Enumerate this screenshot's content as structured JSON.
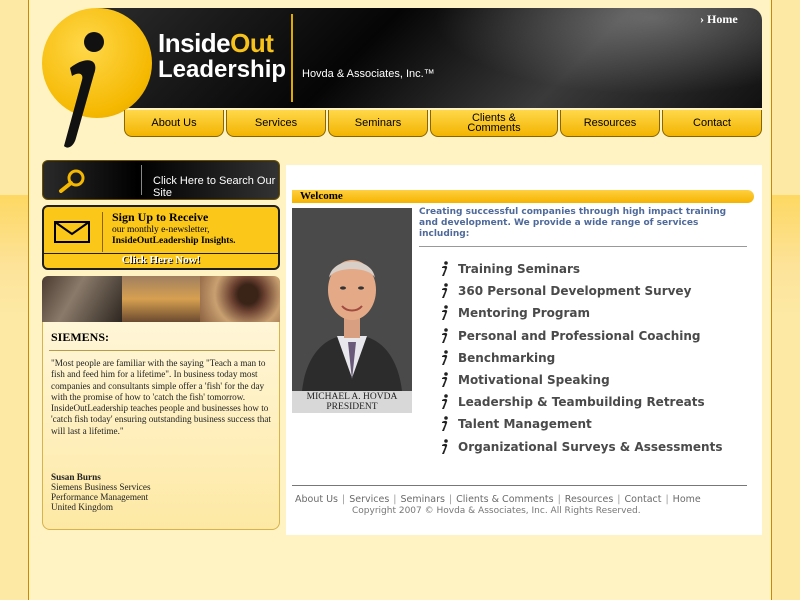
{
  "header": {
    "home_link": "› Home",
    "brand_part1": "Inside",
    "brand_part2": "Out",
    "brand_line2": "Leadership",
    "company": "Hovda & Associates, Inc.™"
  },
  "nav": [
    {
      "label": "About Us"
    },
    {
      "label": "Services"
    },
    {
      "label": "Seminars"
    },
    {
      "label": "Clients & Comments"
    },
    {
      "label": "Resources"
    },
    {
      "label": "Contact"
    }
  ],
  "sidebar": {
    "search_label": "Click Here to Search Our Site",
    "signup_title": "Sign Up to Receive",
    "signup_sub": "our monthly e-newsletter,",
    "signup_sub2": "InsideOutLeadership Insights.",
    "signup_button": "Click Here Now!",
    "testimonial": {
      "company": "SIEMENS:",
      "quote": "\"Most people are familiar with the saying \"Teach a man to fish and feed him for a lifetime\". In business today most companies and consultants simple offer a 'fish' for the day with the promise of how to 'catch the fish' tomorrow. InsideOutLeadership teaches people and businesses how to 'catch fish today' ensuring outstanding business success that will last a lifetime.\"",
      "author_name": "Susan Burns",
      "author_line2": "Siemens Business Services",
      "author_line3": "Performance Management",
      "author_line4": "United Kingdom"
    }
  },
  "main": {
    "welcome_title": "Welcome",
    "portrait_name": "MICHAEL A. HOVDA",
    "portrait_title": "PRESIDENT",
    "intro": "Creating successful companies through high impact training and development. We provide a wide range of services including:",
    "services": [
      "Training Seminars",
      "360 Personal Development Survey",
      "Mentoring Program",
      "Personal and Professional Coaching",
      "Benchmarking",
      "Motivational Speaking",
      "Leadership & Teambuilding Retreats",
      "Talent Management",
      "Organizational Surveys & Assessments"
    ]
  },
  "footer": {
    "links": [
      "About Us",
      "Services",
      "Seminars",
      "Clients & Comments",
      "Resources",
      "Contact",
      "Home"
    ],
    "copyright": "Copyright 2007 © Hovda & Associates, Inc. All Rights Reserved."
  },
  "colors": {
    "accent_yellow": "#f5b800",
    "header_black": "#050505",
    "intro_blue": "#4f6a9a"
  }
}
